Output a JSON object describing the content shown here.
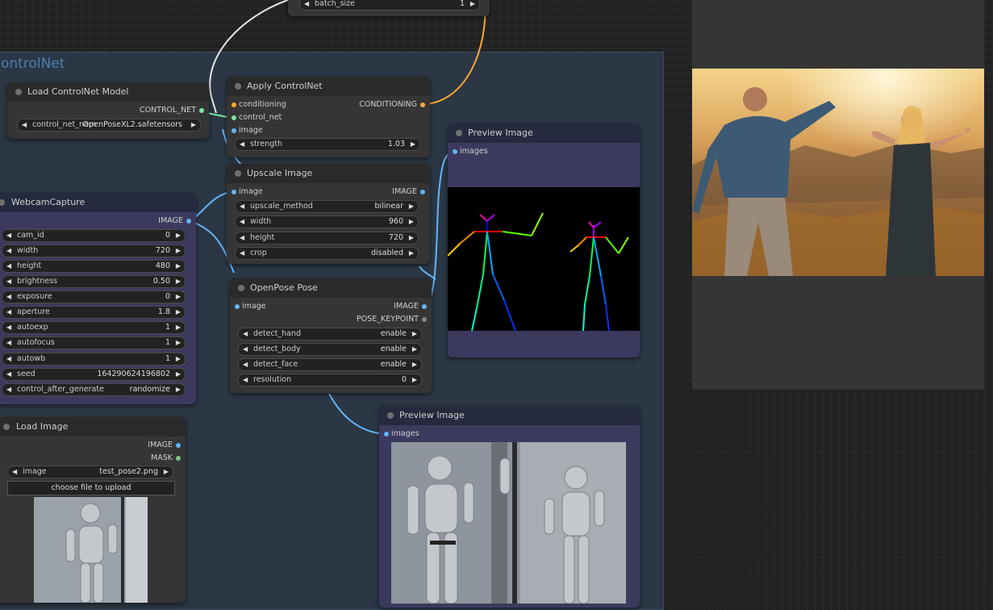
{
  "group": {
    "title": "ontrolNet"
  },
  "batch_node": {
    "widget": {
      "label": "batch_size",
      "value": "1"
    }
  },
  "load_controlnet": {
    "title": "Load ControlNet Model",
    "output": "CONTROL_NET",
    "widget": {
      "label": "control_net_nam",
      "value": "OpenPoseXL2.safetensors"
    }
  },
  "apply_controlnet": {
    "title": "Apply ControlNet",
    "inputs": [
      "conditioning",
      "control_net",
      "image"
    ],
    "output": "CONDITIONING",
    "widget": {
      "label": "strength",
      "value": "1.03"
    }
  },
  "upscale": {
    "title": "Upscale Image",
    "input": "image",
    "output": "IMAGE",
    "widgets": [
      {
        "label": "upscale_method",
        "value": "bilinear"
      },
      {
        "label": "width",
        "value": "960"
      },
      {
        "label": "height",
        "value": "720"
      },
      {
        "label": "crop",
        "value": "disabled"
      }
    ]
  },
  "webcam": {
    "title": "WebcamCapture",
    "output": "IMAGE",
    "widgets": [
      {
        "label": "cam_id",
        "value": "0"
      },
      {
        "label": "width",
        "value": "720"
      },
      {
        "label": "height",
        "value": "480"
      },
      {
        "label": "brightness",
        "value": "0.50"
      },
      {
        "label": "exposure",
        "value": "0"
      },
      {
        "label": "aperture",
        "value": "1.8"
      },
      {
        "label": "autoexp",
        "value": "1"
      },
      {
        "label": "autofocus",
        "value": "1"
      },
      {
        "label": "autowb",
        "value": "1"
      },
      {
        "label": "seed",
        "value": "164290624196802"
      },
      {
        "label": "control_after_generate",
        "value": "randomize"
      }
    ]
  },
  "openpose": {
    "title": "OpenPose Pose",
    "input": "image",
    "outputs": [
      "IMAGE",
      "POSE_KEYPOINT"
    ],
    "widgets": [
      {
        "label": "detect_hand",
        "value": "enable"
      },
      {
        "label": "detect_body",
        "value": "enable"
      },
      {
        "label": "detect_face",
        "value": "enable"
      },
      {
        "label": "resolution",
        "value": "0"
      }
    ]
  },
  "preview1": {
    "title": "Preview Image",
    "input": "images"
  },
  "preview2": {
    "title": "Preview Image",
    "input": "images"
  },
  "load_image": {
    "title": "Load Image",
    "outputs": [
      "IMAGE",
      "MASK"
    ],
    "widget": {
      "label": "image",
      "value": "test_pose2.png"
    },
    "upload_label": "choose file to upload"
  },
  "colors": {
    "image": "#64b5f6",
    "conditioning": "#ffa931",
    "control_net": "#7ae4a4",
    "mask": "#81c784",
    "canvas": "#222222",
    "group": "#2b3745"
  },
  "icons": [
    "arrow-left-icon",
    "arrow-right-icon",
    "node-collapse-dot-icon"
  ]
}
